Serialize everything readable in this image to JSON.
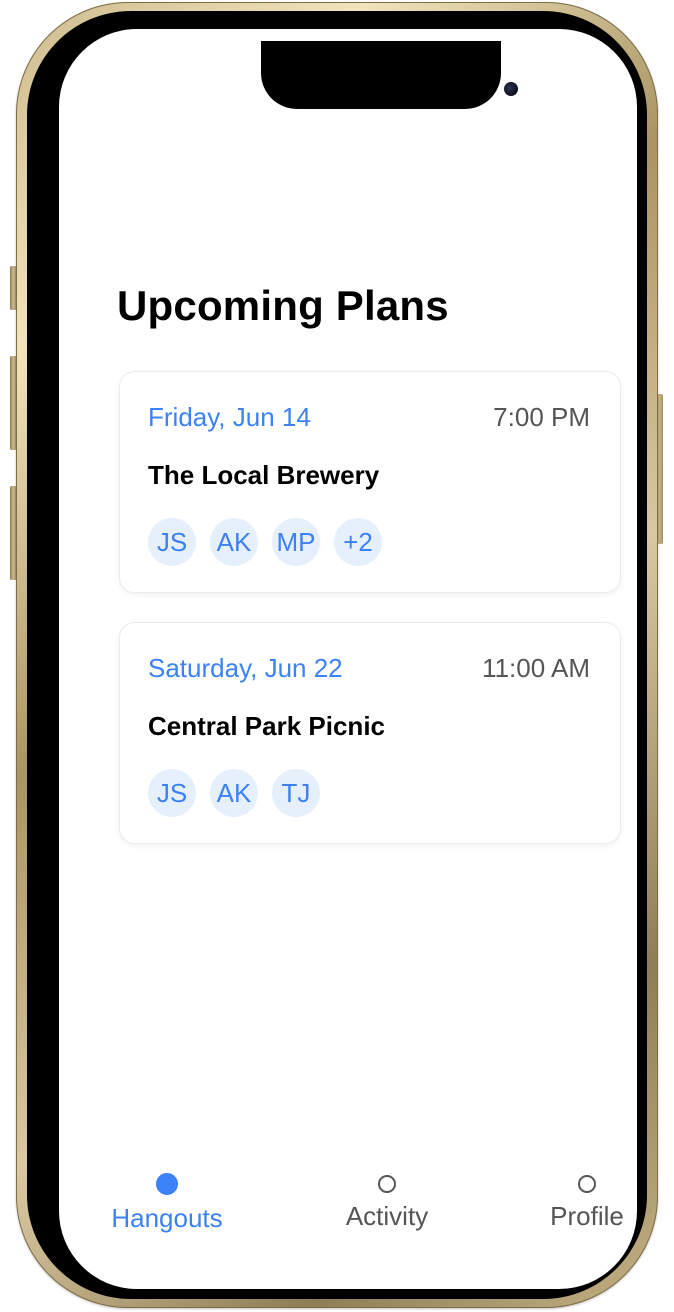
{
  "screen": {
    "title": "Upcoming Plans"
  },
  "plans": [
    {
      "date": "Friday, Jun 14",
      "time": "7:00 PM",
      "place": "The Local Brewery",
      "attendees": [
        "JS",
        "AK",
        "MP",
        "+2"
      ]
    },
    {
      "date": "Saturday, Jun 22",
      "time": "11:00 AM",
      "place": "Central Park Picnic",
      "attendees": [
        "JS",
        "AK",
        "TJ"
      ]
    }
  ],
  "nav": {
    "active": "Hangouts",
    "tabs": [
      {
        "label": "Hangouts",
        "icon": "filled-circle-icon"
      },
      {
        "label": "Activity",
        "icon": "circle-outline-icon"
      },
      {
        "label": "Profile",
        "icon": "circle-outline-icon"
      }
    ]
  },
  "colors": {
    "accent": "#3b82f6",
    "avatar_bg": "#e6f0fd",
    "muted_text": "#555555",
    "frame_gold": "#cdbb8d"
  }
}
